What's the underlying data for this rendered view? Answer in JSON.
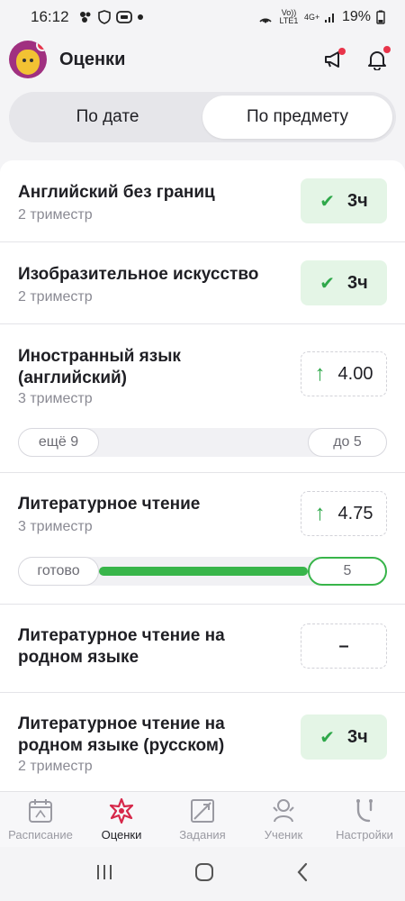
{
  "status": {
    "time": "16:12",
    "network": "Vo)) LTE1",
    "signal_4g": "4G+",
    "battery": "19%"
  },
  "header": {
    "title": "Оценки"
  },
  "segment": {
    "by_date": "По дате",
    "by_subject": "По предмету",
    "selected": "По предмету"
  },
  "subjects": [
    {
      "name": "Английский без границ",
      "term": "2 триместр",
      "grade": "3ч",
      "grade_type": "pass"
    },
    {
      "name": "Изобразительное искусство",
      "term": "2 триместр",
      "grade": "3ч",
      "grade_type": "pass"
    },
    {
      "name_line1": "Иностранный язык",
      "name_line2": "(английский)",
      "term": "3 триместр",
      "grade": "4.00",
      "grade_type": "up",
      "progress": {
        "left": "ещё 9",
        "right": "до 5",
        "fill": 0
      }
    },
    {
      "name": "Литературное чтение",
      "term": "3 триместр",
      "grade": "4.75",
      "grade_type": "up",
      "progress": {
        "left": "готово",
        "right": "5",
        "fill": 1
      }
    },
    {
      "name_line1": "Литературное чтение на",
      "name_line2": "родном языке",
      "grade": "–",
      "grade_type": "none"
    },
    {
      "name_line1": "Литературное чтение на",
      "name_line2": "родном языке (русском)",
      "term": "2 триместр",
      "grade": "3ч",
      "grade_type": "pass"
    }
  ],
  "nav": [
    {
      "label": "Расписание",
      "icon": "calendar-icon",
      "active": false
    },
    {
      "label": "Оценки",
      "icon": "grades-star-icon",
      "active": true
    },
    {
      "label": "Задания",
      "icon": "tasks-icon",
      "active": false
    },
    {
      "label": "Ученик",
      "icon": "student-icon",
      "active": false
    },
    {
      "label": "Настройки",
      "icon": "settings-icon",
      "active": false
    }
  ],
  "colors": {
    "accent_green": "#38b54a",
    "pass_bg": "#e4f5e6",
    "active_nav_icon": "#d6284a",
    "notification": "#e8344a"
  }
}
